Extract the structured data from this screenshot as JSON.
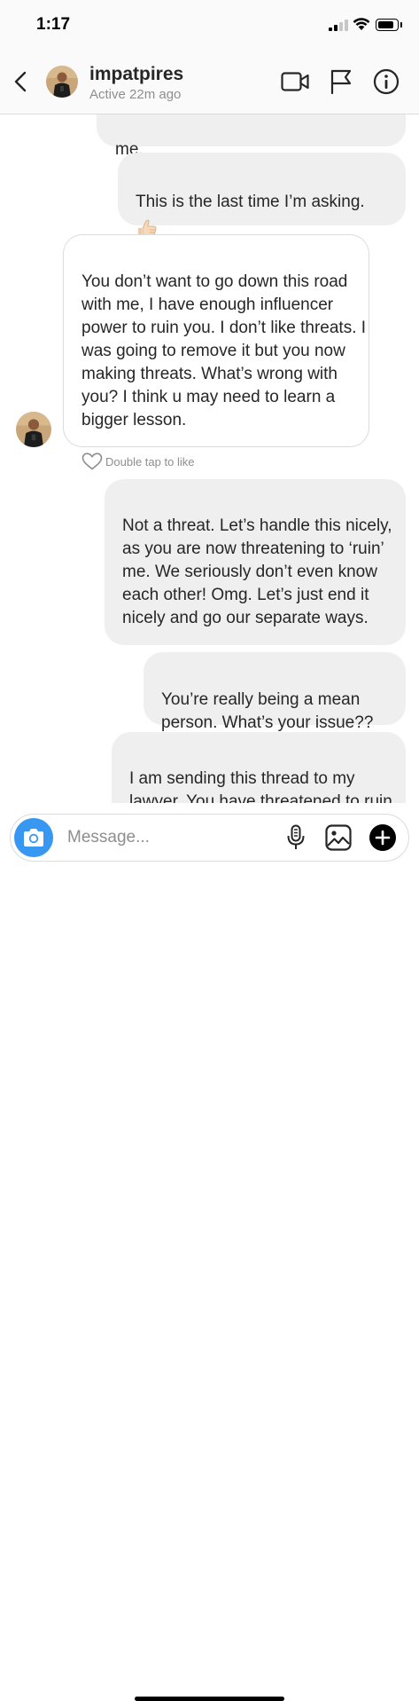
{
  "status_bar": {
    "time": "1:17"
  },
  "header": {
    "username": "impatpires",
    "status": "Active 22m ago"
  },
  "messages": [
    {
      "dir": "out",
      "text": "me."
    },
    {
      "dir": "out",
      "text": "This is the last time I’m asking.",
      "emoji": "thumbs-up"
    },
    {
      "dir": "in",
      "text": "You don’t want to go down this road with me, I have enough influencer power to ruin you.  I don’t like threats.   I was going to remove it but you now making threats.  What’s wrong with you?  I think u may need to learn a bigger lesson."
    },
    {
      "dir": "out",
      "text": "Not a threat. Let’s handle this nicely, as you are now threatening to ‘ruin’ me. We seriously don’t even know each other! Omg. Let’s just end it nicely and go our separate ways."
    },
    {
      "dir": "out",
      "text": "You’re really being a mean person. What’s your issue??"
    },
    {
      "dir": "out",
      "text": "I am sending this thread to my lawyer. You have threatened to ruin me. I’ve been more than"
    }
  ],
  "like_hint": "Double tap to like",
  "composer": {
    "placeholder": "Message..."
  }
}
